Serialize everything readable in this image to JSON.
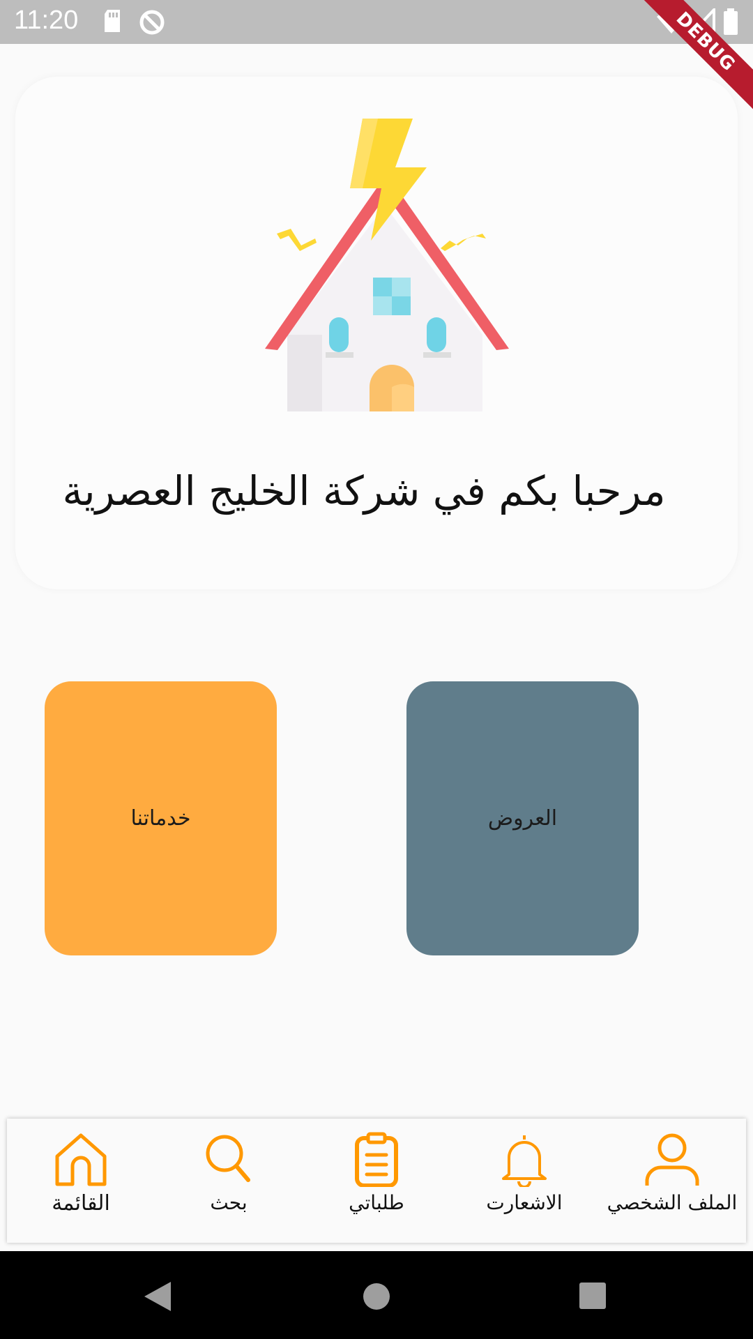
{
  "status_bar": {
    "time": "11:20",
    "icons": [
      "sd-card-icon",
      "sync-icon",
      "wifi-icon",
      "signal-icon",
      "battery-icon"
    ],
    "debug_label": "DEBUG"
  },
  "hero": {
    "illustration": "house-lightning-icon",
    "welcome_text": "مرحبا بكم في شركة الخليج العصرية"
  },
  "tiles": [
    {
      "label": "خدماتنا",
      "color": "#ffab40"
    },
    {
      "label": "العروض",
      "color": "#607d8b"
    }
  ],
  "bottom_nav": {
    "accent_color": "#ff9800",
    "items": [
      {
        "label": "القائمة",
        "icon": "home-icon",
        "active": true
      },
      {
        "label": "بحث",
        "icon": "search-icon"
      },
      {
        "label": "طلباتي",
        "icon": "clipboard-icon"
      },
      {
        "label": "الاشعارت",
        "icon": "bell-icon"
      },
      {
        "label": "الملف الشخصي",
        "icon": "user-icon"
      }
    ]
  },
  "system_nav": {
    "icons": [
      "back-icon",
      "home-circle-icon",
      "recents-icon"
    ]
  }
}
